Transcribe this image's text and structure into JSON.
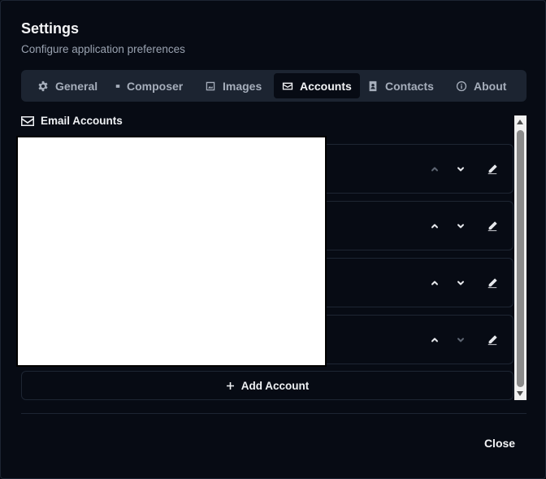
{
  "dialog": {
    "title": "Settings",
    "subtitle": "Configure application preferences"
  },
  "tabs": [
    {
      "label": "General",
      "icon": "gear-icon"
    },
    {
      "label": "Composer",
      "icon": "composer-icon"
    },
    {
      "label": "Images",
      "icon": "image-icon"
    },
    {
      "label": "Accounts",
      "icon": "envelope-icon",
      "active": true
    },
    {
      "label": "Contacts",
      "icon": "contact-card-icon"
    },
    {
      "label": "About",
      "icon": "info-icon"
    }
  ],
  "section": {
    "title": "Email Accounts",
    "icon": "envelope-icon"
  },
  "accounts": [
    {
      "move_up_enabled": false,
      "move_down_enabled": true
    },
    {
      "move_up_enabled": true,
      "move_down_enabled": true
    },
    {
      "move_up_enabled": true,
      "move_down_enabled": true
    },
    {
      "move_up_enabled": true,
      "move_down_enabled": false
    }
  ],
  "add_account_label": "Add Account",
  "close_label": "Close",
  "colors": {
    "background": "#070b14",
    "tab_bar": "#1c2431",
    "border": "#1e2633",
    "text": "#f3f4f6",
    "muted_text": "#9aa3b1"
  }
}
